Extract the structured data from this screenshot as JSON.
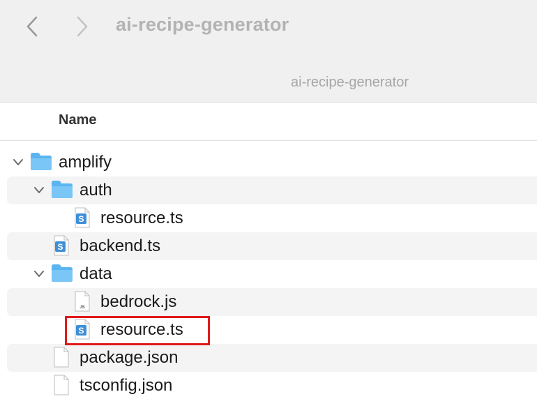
{
  "window": {
    "title": "ai-recipe-generator",
    "path": "ai-recipe-generator"
  },
  "columns": {
    "name": "Name"
  },
  "colors": {
    "folder": "#5bb4f0",
    "ts_badge": "#3f8fd6",
    "highlight": "#e0191b"
  },
  "rows": [
    {
      "label": "amplify",
      "icon": "folder-icon"
    },
    {
      "label": "auth",
      "icon": "folder-icon"
    },
    {
      "label": "resource.ts",
      "icon": "typescript-file-icon"
    },
    {
      "label": "backend.ts",
      "icon": "typescript-file-icon"
    },
    {
      "label": "data",
      "icon": "folder-icon"
    },
    {
      "label": "bedrock.js",
      "icon": "javascript-file-icon",
      "badge": "JS"
    },
    {
      "label": "resource.ts",
      "icon": "typescript-file-icon"
    },
    {
      "label": "package.json",
      "icon": "blank-file-icon"
    },
    {
      "label": "tsconfig.json",
      "icon": "blank-file-icon"
    }
  ]
}
